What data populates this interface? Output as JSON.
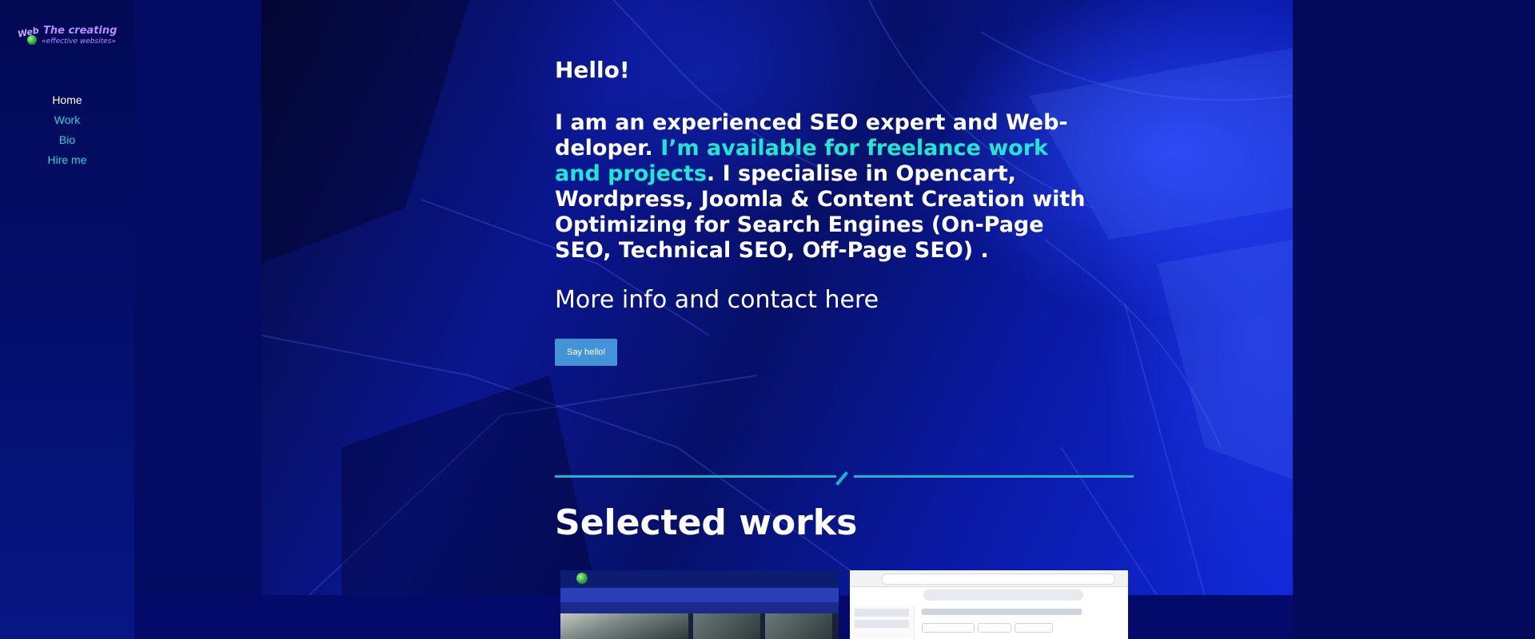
{
  "logo": {
    "web": "Web",
    "line1": "The creating",
    "line2": "«effective websites»"
  },
  "nav": {
    "items": [
      {
        "label": "Home"
      },
      {
        "label": "Work"
      },
      {
        "label": "Bio"
      },
      {
        "label": "Hire me"
      }
    ]
  },
  "hero": {
    "greeting": "Hello!",
    "intro_part1": "I am an experienced SEO expert and Web-deloper. ",
    "intro_highlight": "I’m available for freelance work and projects",
    "intro_part2": ". I specialise in Opencart, Wordpress, Joomla & Content Creation with Optimizing for Search Engines (On-Page SEO, Technical SEO, Off-Page SEO) .",
    "more_info": "More info and contact here",
    "cta_label": "Say hello!"
  },
  "works": {
    "heading": "Selected works"
  },
  "colors": {
    "accent": "#1fe8d2",
    "button": "#4394d7",
    "nav_link": "#23d6d6",
    "divider": "#19b7c9"
  }
}
